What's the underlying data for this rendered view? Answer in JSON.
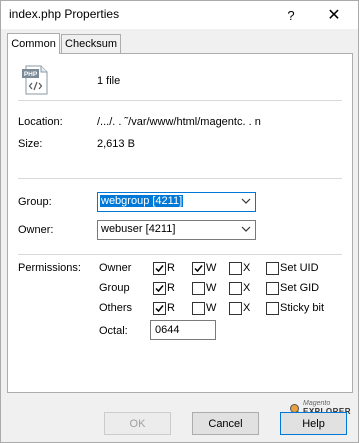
{
  "window": {
    "title": "index.php Properties"
  },
  "titlebar": {
    "help": "?",
    "close": "✕"
  },
  "tabs": [
    {
      "label": "Common",
      "active": true
    },
    {
      "label": "Checksum",
      "active": false
    }
  ],
  "file": {
    "icon_text": "PHP",
    "count": "1 file"
  },
  "info": {
    "location_label": "Location:",
    "location_value": "/.../. . ˜/var/www/html/magentc.           . n",
    "size_label": "Size:",
    "size_value": "2,613 B"
  },
  "ownership": {
    "group_label": "Group:",
    "group_value": "webgroup [4211]",
    "owner_label": "Owner:",
    "owner_value": "webuser [4211]"
  },
  "permissions": {
    "label": "Permissions:",
    "rows": [
      {
        "name": "Owner",
        "r": true,
        "w": true,
        "x": false,
        "extra_label": "Set UID",
        "extra": false
      },
      {
        "name": "Group",
        "r": true,
        "w": false,
        "x": false,
        "extra_label": "Set GID",
        "extra": false
      },
      {
        "name": "Others",
        "r": true,
        "w": false,
        "x": false,
        "extra_label": "Sticky bit",
        "extra": false
      }
    ],
    "r_label": "R",
    "w_label": "W",
    "x_label": "X",
    "octal_label": "Octal:",
    "octal_value": "0644"
  },
  "buttons": {
    "ok": "OK",
    "cancel": "Cancel",
    "help": "Help"
  },
  "watermark": {
    "line1": "Magento",
    "line2": "EXPLORER"
  },
  "colors": {
    "accent": "#0078d7",
    "php_icon": "#7a8a96"
  }
}
